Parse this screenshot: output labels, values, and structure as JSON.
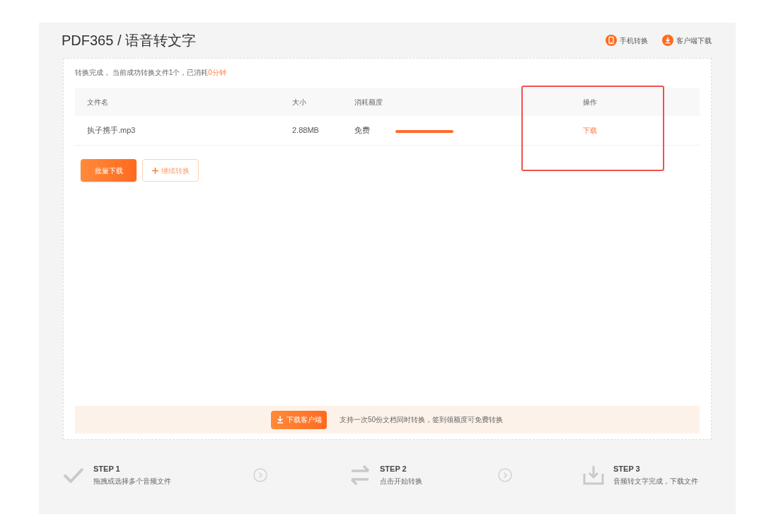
{
  "header": {
    "title": "PDF365 / 语音转文字",
    "links": [
      {
        "label": "手机转换",
        "kind": "phone"
      },
      {
        "label": "客户端下载",
        "kind": "download"
      }
    ]
  },
  "status": {
    "message": "转换完成， 当前成功转换文件1个，已消耗",
    "consumed": "0分钟"
  },
  "table": {
    "columns": [
      {
        "label": "文件名",
        "highlighted": false
      },
      {
        "label": "大小",
        "highlighted": false
      },
      {
        "label": "消耗额度",
        "highlighted": false
      },
      {
        "label": "操作",
        "highlighted": true
      }
    ],
    "rows": [
      {
        "name": "执子携手.mp3",
        "size": "2.88MB",
        "quota": "免费",
        "marked": true,
        "action": "下载"
      }
    ]
  },
  "buttons": [
    {
      "label": "批量下载",
      "kind": "primary"
    },
    {
      "label": "继续转换",
      "kind": "add"
    }
  ],
  "banner": {
    "button": "下载客户端",
    "text": "支持一次50份文档同时转换，签到领额度可免费转换"
  },
  "steps": [
    {
      "title": "STEP 1",
      "text": "拖拽或选择多个音频文件",
      "kind": "check"
    },
    {
      "title": "STEP 2",
      "text": "点击开始转换",
      "kind": "convert"
    },
    {
      "title": "STEP 3",
      "text": "音频转文字完成，下载文件",
      "kind": "download"
    }
  ]
}
